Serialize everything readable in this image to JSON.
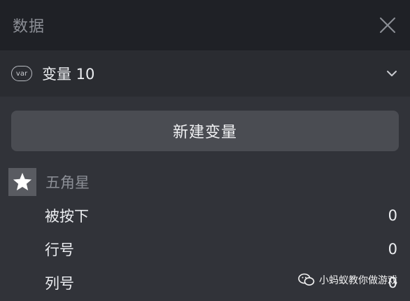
{
  "header": {
    "title": "数据",
    "close_icon": "close-icon"
  },
  "variable_selector": {
    "badge": "var",
    "label": "变量 10",
    "chevron_icon": "chevron-down-icon"
  },
  "new_variable_button": {
    "label": "新建变量"
  },
  "sprite_group": {
    "icon": "star-icon",
    "name": "五角星",
    "variables": [
      {
        "name": "被按下",
        "value": "0"
      },
      {
        "name": "行号",
        "value": "0"
      },
      {
        "name": "列号",
        "value": "0"
      }
    ]
  },
  "watermark": {
    "text": "小蚂蚁教你做游戏",
    "icon": "wechat-icon"
  }
}
